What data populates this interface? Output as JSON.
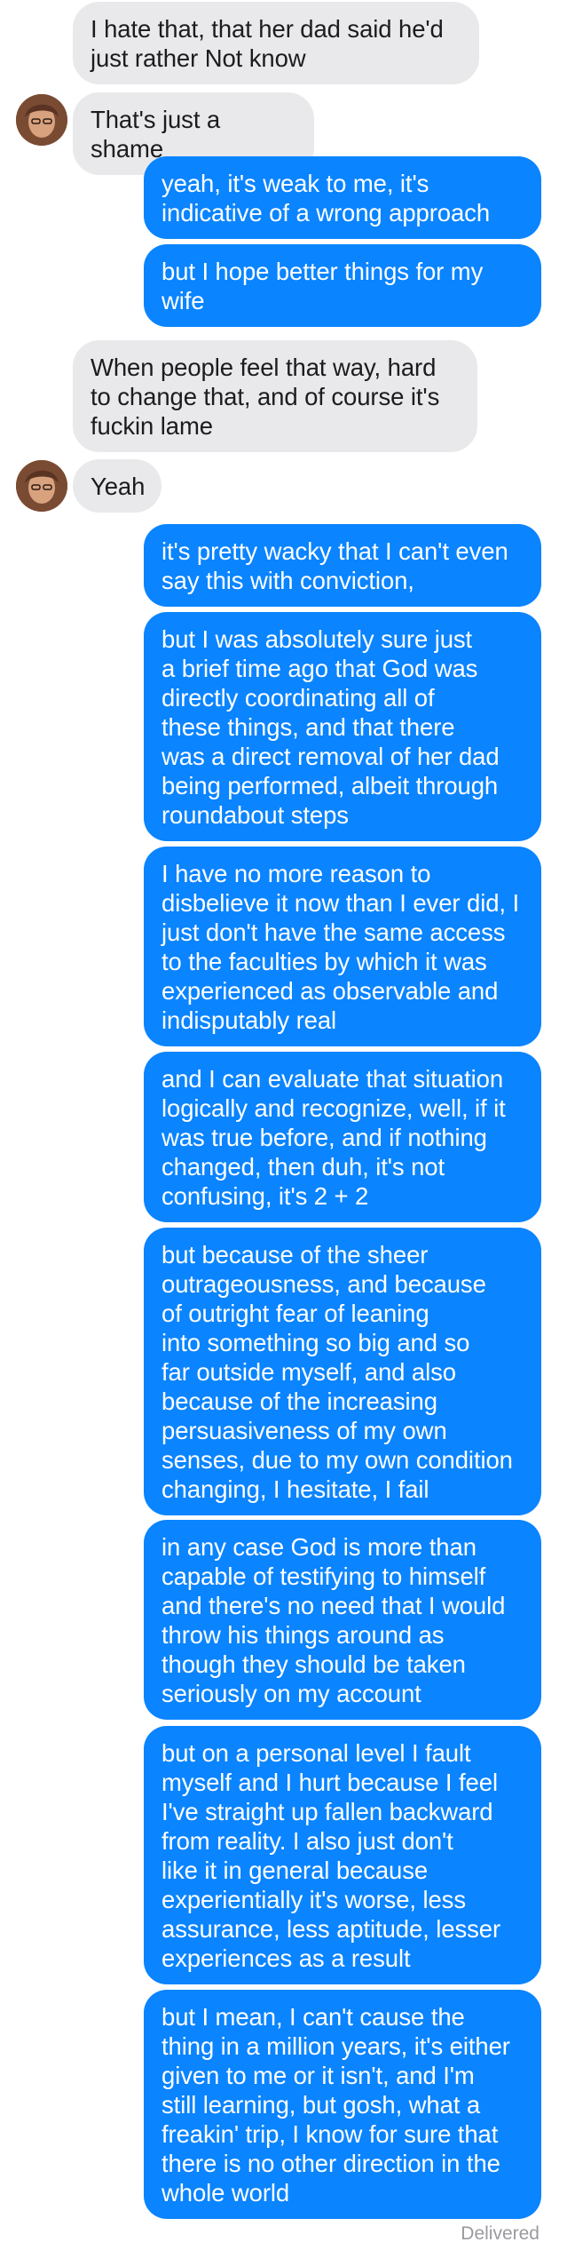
{
  "conversation": {
    "messages": [
      {
        "sender": "them",
        "text": "I hate that, that her dad said he'd\njust rather Not know"
      },
      {
        "sender": "them",
        "text": "That's just a shame",
        "avatar": true
      },
      {
        "sender": "me",
        "text": "yeah, it's weak to me, it's\nindicative of a wrong approach"
      },
      {
        "sender": "me",
        "text": "but I hope better things for my\nwife"
      },
      {
        "sender": "them",
        "text": "When people feel that way, hard\nto change that, and of course it's\nfuckin lame"
      },
      {
        "sender": "them",
        "text": "Yeah",
        "avatar": true
      },
      {
        "sender": "me",
        "text": "it's pretty wacky that I can't even\nsay this with conviction,"
      },
      {
        "sender": "me",
        "text": "but I was absolutely sure just\na brief time ago that God was\ndirectly coordinating all of\nthese things, and that there\nwas a direct removal of her dad\nbeing performed, albeit through\nroundabout steps"
      },
      {
        "sender": "me",
        "text": "I have no more reason to\ndisbelieve it now than I ever did, I\njust don't have the same access\nto the faculties by which it was\nexperienced as observable and\nindisputably real"
      },
      {
        "sender": "me",
        "text": "and I can evaluate that situation\nlogically and recognize, well, if it\nwas true before, and if nothing\nchanged, then duh, it's not\nconfusing, it's 2 + 2"
      },
      {
        "sender": "me",
        "text": "but because of the sheer\noutrageousness, and because\nof outright fear of leaning\ninto something so big and so\nfar outside myself, and also\nbecause of the increasing\npersuasiveness of my own\nsenses, due to my own condition\nchanging, I hesitate, I fail"
      },
      {
        "sender": "me",
        "text": "in any case God is more than\ncapable of testifying to himself\nand there's no need that I would\nthrow his things around as\nthough they should be taken\nseriously on my account"
      },
      {
        "sender": "me",
        "text": "but on a personal level I fault\nmyself and I hurt because I feel\nI've straight up fallen backward\nfrom reality. I also just don't\nlike it in general because\nexperientially it's worse, less\nassurance, less aptitude, lesser\nexperiences as a result"
      },
      {
        "sender": "me",
        "text": "but I mean, I can't cause the\nthing in a million years, it's either\ngiven to me or it isn't, and I'm\nstill learning, but gosh, what a\nfreakin' trip, I know for sure that\nthere is no other direction in the\nwhole world"
      }
    ],
    "status": "Delivered",
    "colors": {
      "outgoing_bubble": "#0a84ff",
      "incoming_bubble": "#e9e9eb",
      "status_text": "#9a9aa0"
    }
  }
}
